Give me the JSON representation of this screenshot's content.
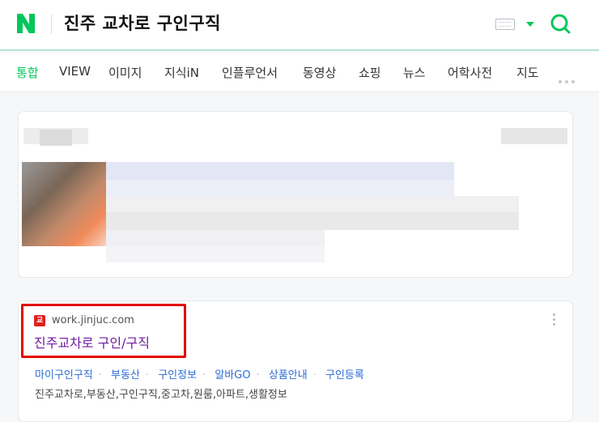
{
  "header": {
    "logo_letter": "N",
    "query": "진주 교차로 구인구직",
    "brand_color": "#03c75a"
  },
  "tabs": [
    "통합",
    "VIEW",
    "이미지",
    "지식iN",
    "인플루언서",
    "동영상",
    "쇼핑",
    "뉴스",
    "어학사전",
    "지도"
  ],
  "result": {
    "favicon_text": "교",
    "url": "work.jinjuc.com",
    "title": "진주교차로 구인/구직",
    "sublinks": [
      "마이구인구직",
      "부동산",
      "구인정보",
      "알바GO",
      "상품안내",
      "구인등록"
    ],
    "description": "진주교차로,부동산,구인구직,중고차,원룸,아파트,생활정보"
  }
}
